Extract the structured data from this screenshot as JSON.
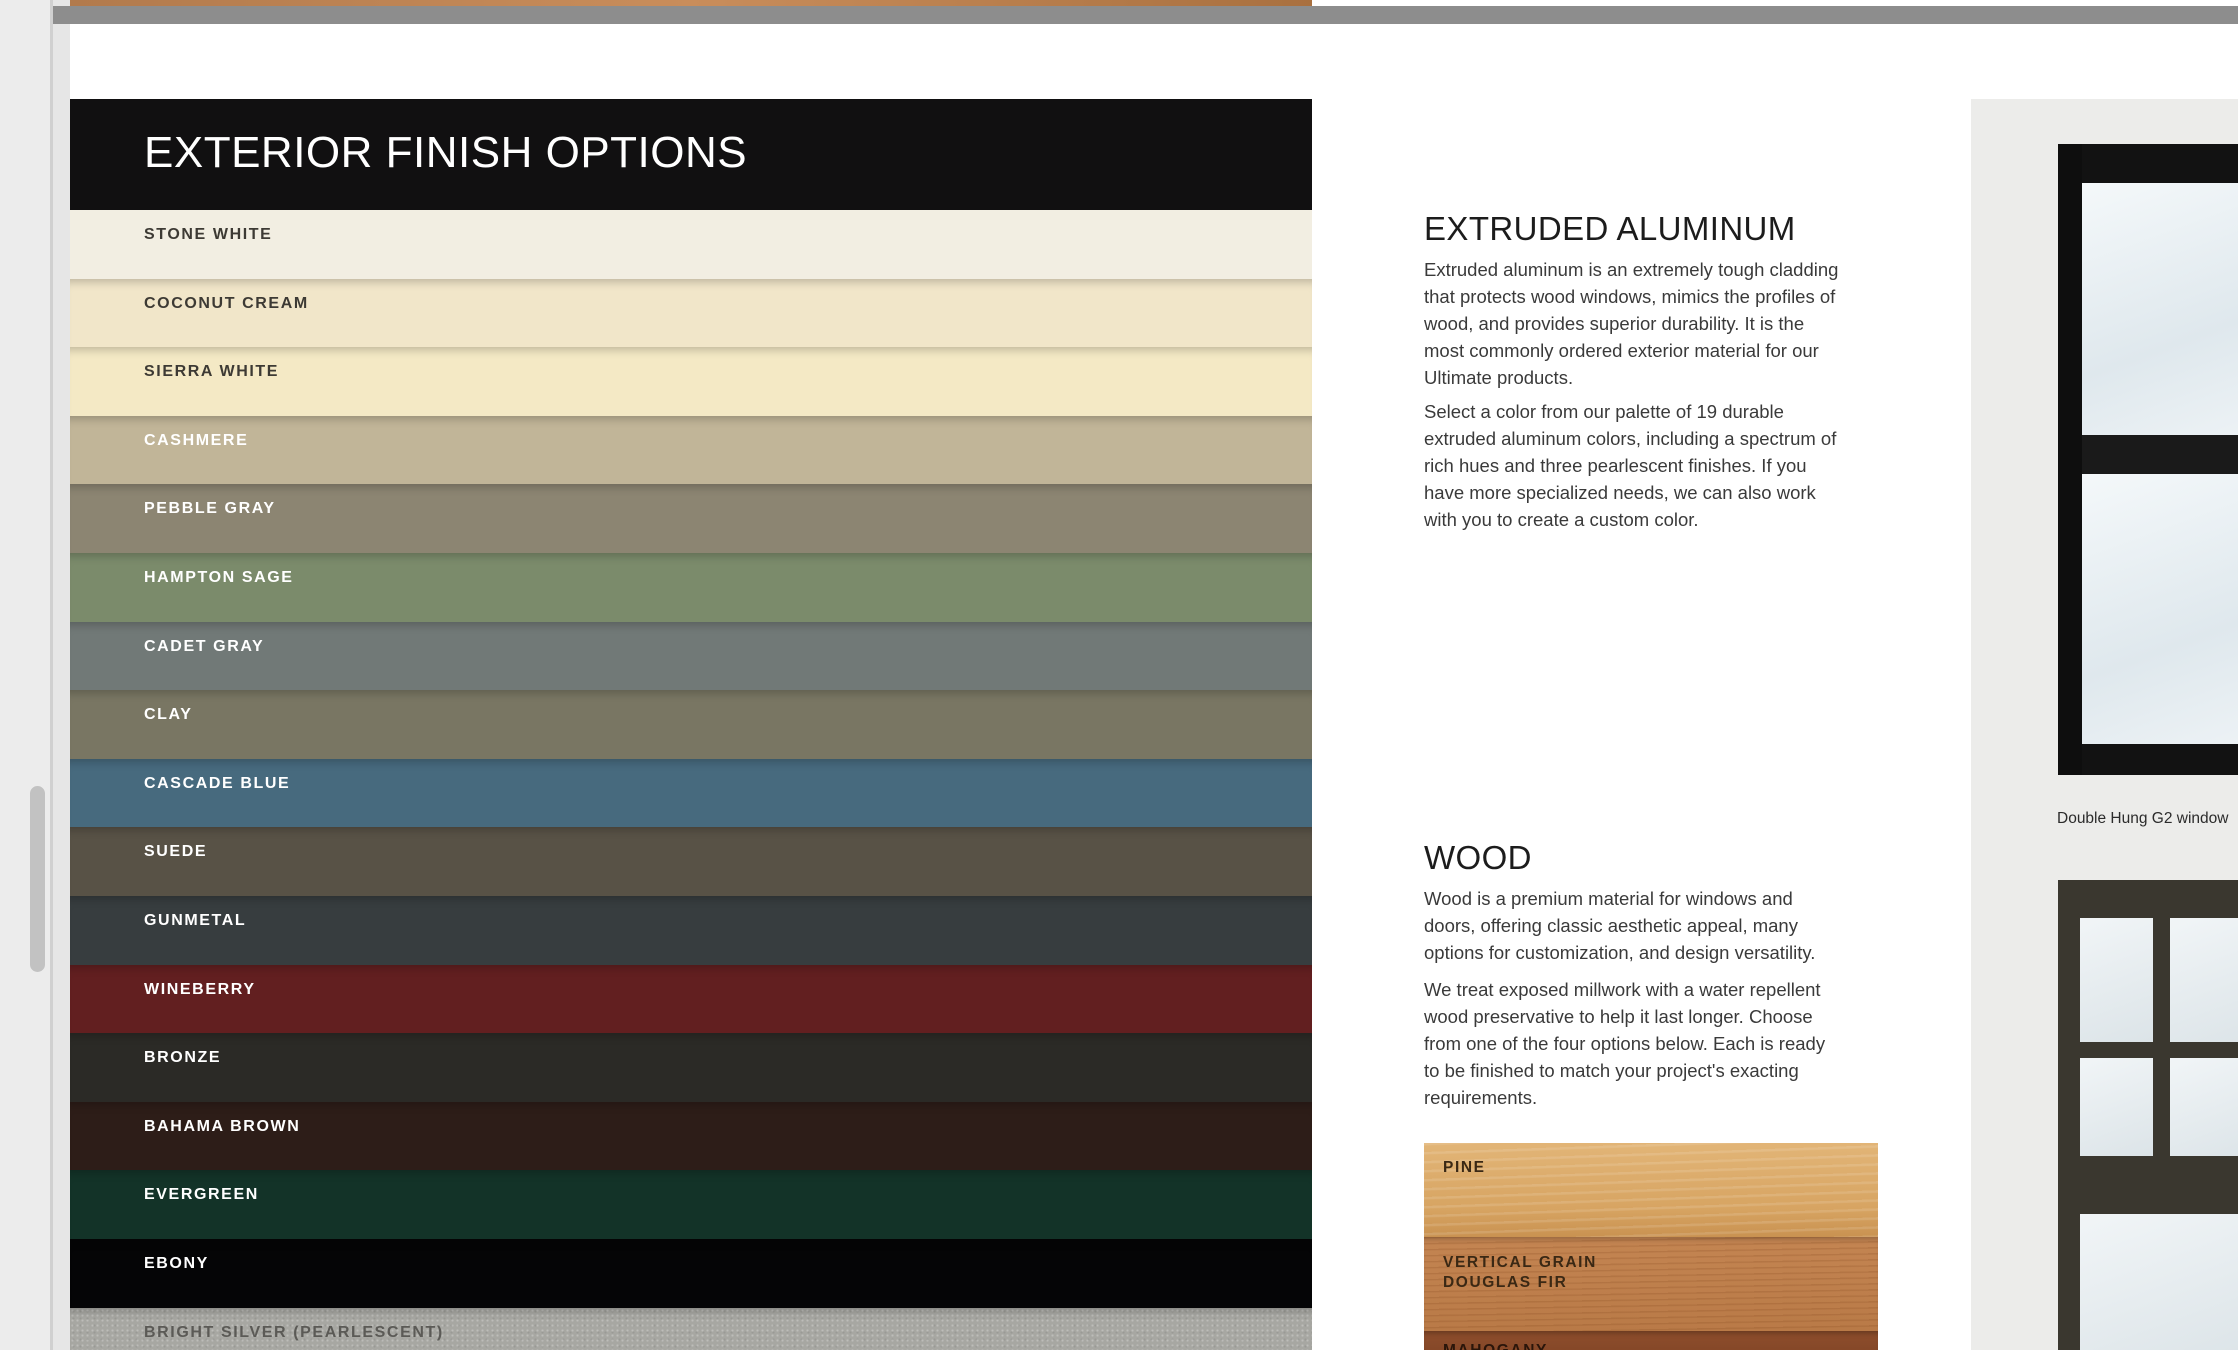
{
  "finish_options": {
    "title": "EXTERIOR FINISH OPTIONS",
    "colors": [
      {
        "name": "STONE WHITE",
        "hex": "#f2eee2",
        "tone": "light"
      },
      {
        "name": "COCONUT CREAM",
        "hex": "#f1e6c9",
        "tone": "light"
      },
      {
        "name": "SIERRA WHITE",
        "hex": "#f4e9c5",
        "tone": "light"
      },
      {
        "name": "CASHMERE",
        "hex": "#c1b598",
        "tone": "dark"
      },
      {
        "name": "PEBBLE GRAY",
        "hex": "#8c8572",
        "tone": "dark"
      },
      {
        "name": "HAMPTON SAGE",
        "hex": "#7b8b6b",
        "tone": "dark"
      },
      {
        "name": "CADET GRAY",
        "hex": "#717977",
        "tone": "dark"
      },
      {
        "name": "CLAY",
        "hex": "#797663",
        "tone": "dark"
      },
      {
        "name": "CASCADE BLUE",
        "hex": "#476a7e",
        "tone": "dark"
      },
      {
        "name": "SUEDE",
        "hex": "#585246",
        "tone": "dark"
      },
      {
        "name": "GUNMETAL",
        "hex": "#373d3f",
        "tone": "dark"
      },
      {
        "name": "WINEBERRY",
        "hex": "#621f20",
        "tone": "dark"
      },
      {
        "name": "BRONZE",
        "hex": "#2b2a26",
        "tone": "dark"
      },
      {
        "name": "BAHAMA BROWN",
        "hex": "#2d1d18",
        "tone": "dark"
      },
      {
        "name": "EVERGREEN",
        "hex": "#133328",
        "tone": "dark"
      },
      {
        "name": "EBONY",
        "hex": "#050506",
        "tone": "dark"
      },
      {
        "name": "BRIGHT SILVER (PEARLESCENT)",
        "hex": "#a7a7a2",
        "tone": "silver"
      }
    ]
  },
  "extruded_aluminum": {
    "heading": "EXTRUDED ALUMINUM",
    "paragraph_1": "Extruded aluminum is an extremely tough cladding that protects wood windows, mimics the profiles of wood, and provides superior durability. It is the most commonly ordered exterior material for our Ultimate products.",
    "paragraph_2": "Select a color from our palette of 19 durable extruded aluminum colors, including a spectrum of rich hues and three pearlescent finishes. If you have more specialized needs, we can also work with you to create a custom color."
  },
  "wood": {
    "heading": "WOOD",
    "paragraph_1": "Wood is a premium material for windows and doors, offering classic aesthetic appeal, many options for customization, and design versatility.",
    "paragraph_2": "We treat exposed millwork with a water repellent wood preservative to help it last longer. Choose from one of the four options below. Each is ready to be finished to match your project's exacting requirements.",
    "species": {
      "pine": "PINE",
      "fir_line_1": "VERTICAL GRAIN",
      "fir_line_2": "DOUGLAS FIR",
      "mahogany": "MAHOGANY"
    }
  },
  "photos": {
    "caption_1": "Double Hung G2 window"
  }
}
